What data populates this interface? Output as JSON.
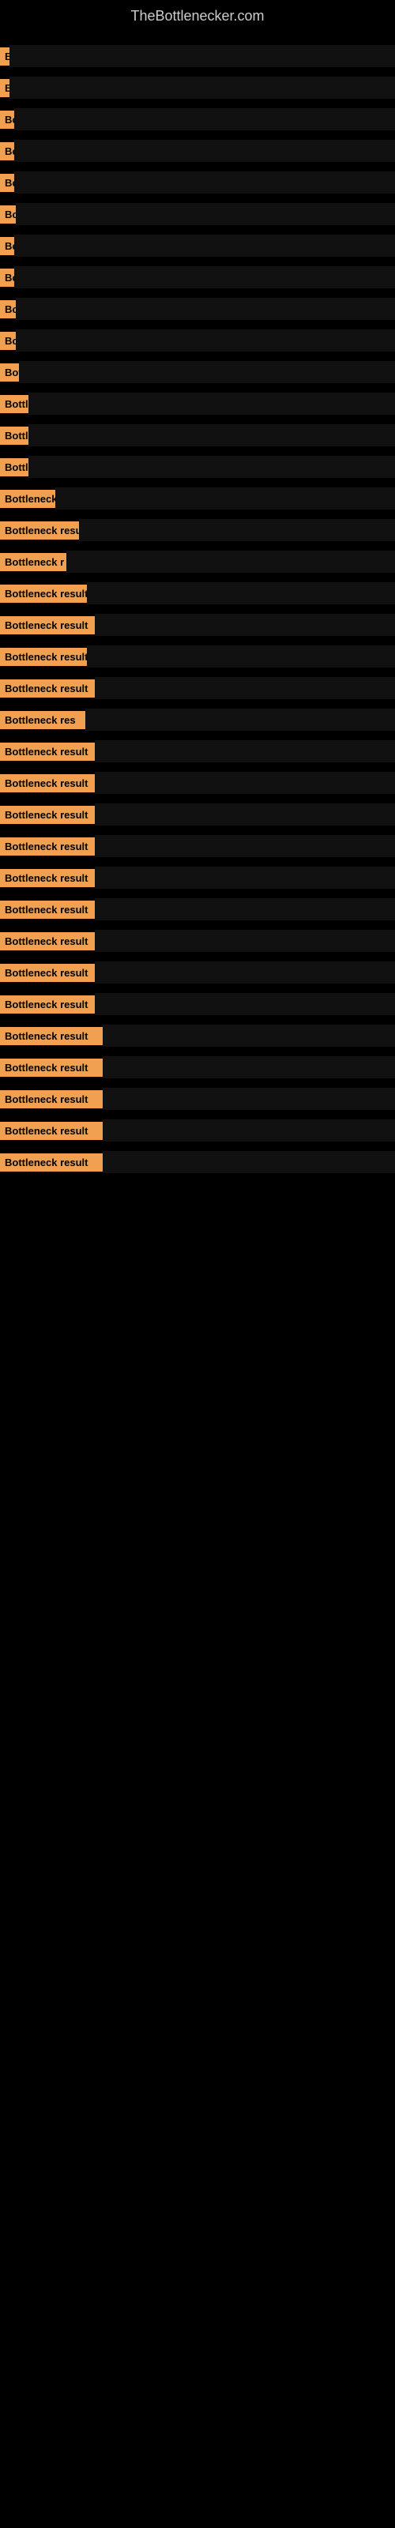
{
  "site": {
    "title": "TheBottlenecker.com"
  },
  "rows": [
    {
      "label": "B",
      "barWidth": 460
    },
    {
      "label": "B",
      "barWidth": 455
    },
    {
      "label": "Bo",
      "barWidth": 445
    },
    {
      "label": "Bo",
      "barWidth": 440
    },
    {
      "label": "Bo",
      "barWidth": 435
    },
    {
      "label": "Bot",
      "barWidth": 428
    },
    {
      "label": "Bo",
      "barWidth": 421
    },
    {
      "label": "Bo",
      "barWidth": 414
    },
    {
      "label": "Bot",
      "barWidth": 406
    },
    {
      "label": "Bot",
      "barWidth": 398
    },
    {
      "label": "Bott",
      "barWidth": 388
    },
    {
      "label": "Bottle",
      "barWidth": 376
    },
    {
      "label": "Bottle",
      "barWidth": 364
    },
    {
      "label": "Bottle",
      "barWidth": 350
    },
    {
      "label": "Bottleneck",
      "barWidth": 334
    },
    {
      "label": "Bottleneck resu",
      "barWidth": 316
    },
    {
      "label": "Bottleneck r",
      "barWidth": 296
    },
    {
      "label": "Bottleneck result",
      "barWidth": 274
    },
    {
      "label": "Bottleneck result",
      "barWidth": 252
    },
    {
      "label": "Bottleneck result",
      "barWidth": 228
    },
    {
      "label": "Bottleneck result",
      "barWidth": 202
    },
    {
      "label": "Bottleneck res",
      "barWidth": 178
    },
    {
      "label": "Bottleneck result",
      "barWidth": 152
    },
    {
      "label": "Bottleneck result",
      "barWidth": 128
    },
    {
      "label": "Bottleneck result",
      "barWidth": 110
    },
    {
      "label": "Bottleneck result",
      "barWidth": 95
    },
    {
      "label": "Bottleneck result",
      "barWidth": 82
    },
    {
      "label": "Bottleneck result",
      "barWidth": 70
    },
    {
      "label": "Bottleneck result",
      "barWidth": 60
    },
    {
      "label": "Bottleneck result",
      "barWidth": 52
    },
    {
      "label": "Bottleneck result",
      "barWidth": 45
    },
    {
      "label": "Bottleneck result",
      "barWidth": 40
    },
    {
      "label": "Bottleneck result",
      "barWidth": 35
    },
    {
      "label": "Bottleneck result",
      "barWidth": 30
    },
    {
      "label": "Bottleneck result",
      "barWidth": 26
    },
    {
      "label": "Bottleneck result",
      "barWidth": 22
    }
  ]
}
